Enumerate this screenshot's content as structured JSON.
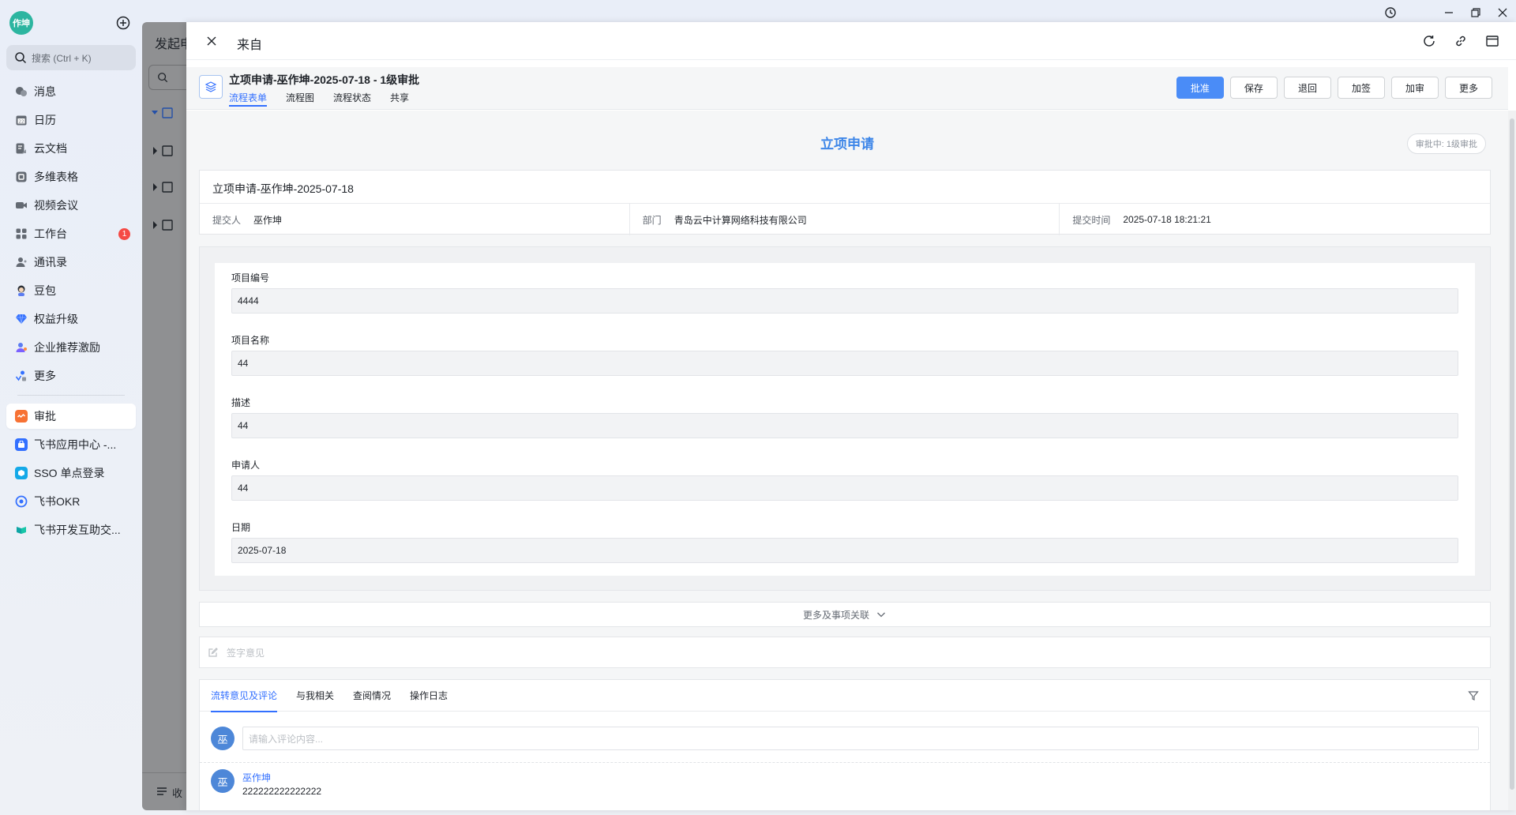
{
  "sidebar": {
    "avatar_text": "作坤",
    "search_placeholder": "搜索 (Ctrl + K)",
    "items": [
      {
        "label": "消息",
        "icon": "message-icon"
      },
      {
        "label": "日历",
        "icon": "calendar-icon"
      },
      {
        "label": "云文档",
        "icon": "docs-icon"
      },
      {
        "label": "多维表格",
        "icon": "base-icon"
      },
      {
        "label": "视频会议",
        "icon": "video-icon"
      },
      {
        "label": "工作台",
        "icon": "workplace-icon",
        "badge": "1"
      },
      {
        "label": "通讯录",
        "icon": "contacts-icon"
      },
      {
        "label": "豆包",
        "icon": "doubao-icon"
      },
      {
        "label": "权益升级",
        "icon": "diamond-icon"
      },
      {
        "label": "企业推荐激励",
        "icon": "referral-icon"
      },
      {
        "label": "更多",
        "icon": "more-icon"
      }
    ],
    "apps": [
      {
        "label": "审批",
        "icon": "approval-app-icon",
        "color": "#f77234"
      },
      {
        "label": "飞书应用中心 -...",
        "icon": "app-center-icon",
        "color": "#3370ff"
      },
      {
        "label": "SSO 单点登录",
        "icon": "sso-icon",
        "color": "#14a9e8"
      },
      {
        "label": "飞书OKR",
        "icon": "okr-icon",
        "color": "#3370ff"
      },
      {
        "label": "飞书开发互助交...",
        "icon": "dev-group-icon",
        "color": "#0fa5a5"
      }
    ]
  },
  "background_panel": {
    "title": "发起申",
    "collapse_label": "收"
  },
  "overlay": {
    "from_label": "来自",
    "process": {
      "title": "立项申请-巫作坤-2025-07-18 - 1级审批",
      "tabs": [
        "流程表单",
        "流程图",
        "流程状态",
        "共享"
      ],
      "actions": [
        "批准",
        "保存",
        "退回",
        "加签",
        "加审",
        "更多"
      ]
    },
    "form": {
      "title": "立项申请",
      "status": "审批中: 1级审批",
      "name": "立项申请-巫作坤-2025-07-18",
      "info": [
        {
          "key": "提交人",
          "value": "巫作坤"
        },
        {
          "key": "部门",
          "value": "青岛云中计算网络科技有限公司"
        },
        {
          "key": "提交时间",
          "value": "2025-07-18 18:21:21"
        }
      ],
      "fields": [
        {
          "label": "项目编号",
          "value": "4444"
        },
        {
          "label": "项目名称",
          "value": "44"
        },
        {
          "label": "描述",
          "value": "44"
        },
        {
          "label": "申请人",
          "value": "44"
        },
        {
          "label": "日期",
          "value": "2025-07-18"
        }
      ],
      "more_label": "更多及事项关联",
      "opinion_placeholder": "签字意见"
    },
    "comments": {
      "tabs": [
        "流转意见及评论",
        "与我相关",
        "查阅情况",
        "操作日志"
      ],
      "avatar_text": "巫",
      "input_placeholder": "请输入评论内容...",
      "entries": [
        {
          "author": "巫作坤",
          "avatar": "巫",
          "text": "222222222222222"
        }
      ]
    }
  },
  "colors": {
    "accent": "#3370ff",
    "primary_button": "#4a8cf7",
    "title_blue": "#3d86e8",
    "badge_red": "#f54a45"
  }
}
